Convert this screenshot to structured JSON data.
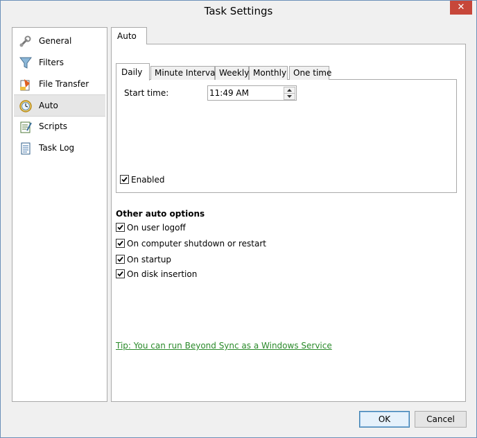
{
  "window": {
    "title": "Task Settings",
    "close_glyph": "✕"
  },
  "sidebar": {
    "items": [
      {
        "label": "General",
        "icon": "wrench-icon"
      },
      {
        "label": "Filters",
        "icon": "funnel-icon"
      },
      {
        "label": "File Transfer",
        "icon": "file-transfer-icon"
      },
      {
        "label": "Auto",
        "icon": "clock-icon",
        "active": true
      },
      {
        "label": "Scripts",
        "icon": "script-icon"
      },
      {
        "label": "Task Log",
        "icon": "log-icon"
      }
    ]
  },
  "main": {
    "tab_label": "Auto",
    "schedule_tabs": [
      "Daily",
      "Minute Interval",
      "Weekly",
      "Monthly",
      "One time"
    ],
    "start_time_label": "Start time:",
    "start_time_value": "11:49 AM",
    "enabled_label": "Enabled",
    "other_heading": "Other auto options",
    "options": [
      {
        "label": "On user logoff",
        "checked": true
      },
      {
        "label": "On computer shutdown or restart",
        "checked": true
      },
      {
        "label": "On startup",
        "checked": true
      },
      {
        "label": "On disk insertion",
        "checked": true
      }
    ],
    "tip_link": "Tip: You can run Beyond Sync as a Windows Service"
  },
  "footer": {
    "ok_label": "OK",
    "cancel_label": "Cancel"
  }
}
